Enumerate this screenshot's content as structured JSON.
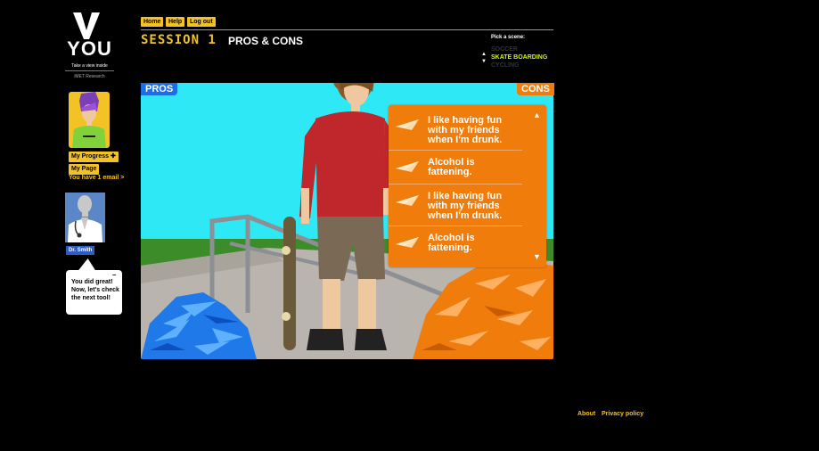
{
  "logo": {
    "title": "YOU",
    "tagline": "Take a view inside",
    "org": "iMET Research"
  },
  "user": {
    "progress_label": "My Progress",
    "page_label": "My Page",
    "email_notice": "You have 1 email >"
  },
  "doctor": {
    "name": "Dr. Smith",
    "message": "You did great! Now, let's check the next tool!"
  },
  "nav": {
    "home": "Home",
    "help": "Help",
    "logout": "Log out"
  },
  "session": {
    "label": "SESSION 1",
    "title": "PROS & CONS"
  },
  "scene_picker": {
    "label": "Pick a scene:",
    "options": [
      "SOCCER",
      "SKATE BOARDING",
      "CYCLING"
    ],
    "selected": "SKATE BOARDING"
  },
  "tags": {
    "pros": "PROS",
    "cons": "CONS"
  },
  "cons_list": [
    "I like having fun with my friends when I'm drunk.",
    "Alcohol is fattening.",
    "I like having fun with my friends when I'm drunk.",
    "Alcohol is fattening."
  ],
  "footer": {
    "about": "About",
    "privacy": "Privacy policy"
  },
  "colors": {
    "accent_yellow": "#f3c326",
    "pros_blue": "#1a6fe6",
    "cons_orange": "#f07c0c",
    "sky": "#2ee8f6",
    "grass": "#3d8c2a"
  }
}
